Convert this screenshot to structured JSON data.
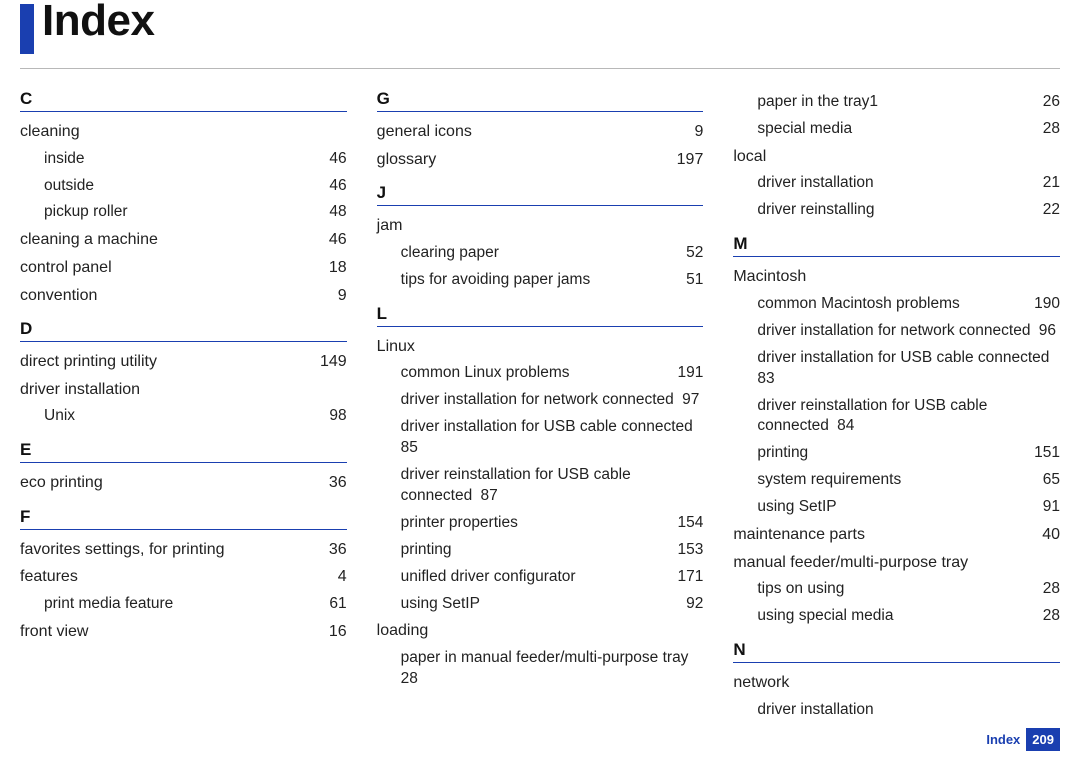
{
  "title": "Index",
  "footer": {
    "label": "Index",
    "page": "209"
  },
  "columns": [
    [
      {
        "type": "letter",
        "text": "C"
      },
      {
        "type": "main",
        "label": "cleaning",
        "page": ""
      },
      {
        "type": "sub",
        "label": "inside",
        "page": "46"
      },
      {
        "type": "sub",
        "label": "outside",
        "page": "46"
      },
      {
        "type": "sub",
        "label": "pickup roller",
        "page": "48"
      },
      {
        "type": "main",
        "label": "cleaning a machine",
        "page": "46"
      },
      {
        "type": "main",
        "label": "control panel",
        "page": "18"
      },
      {
        "type": "main",
        "label": "convention",
        "page": "9"
      },
      {
        "type": "letter",
        "text": "D"
      },
      {
        "type": "main",
        "label": "direct printing utility",
        "page": "149"
      },
      {
        "type": "main",
        "label": "driver installation",
        "page": ""
      },
      {
        "type": "sub",
        "label": "Unix",
        "page": "98"
      },
      {
        "type": "letter",
        "text": "E"
      },
      {
        "type": "main",
        "label": "eco printing",
        "page": "36"
      },
      {
        "type": "letter",
        "text": "F"
      },
      {
        "type": "main",
        "label": "favorites settings, for printing",
        "page": "36"
      },
      {
        "type": "main",
        "label": "features",
        "page": "4"
      },
      {
        "type": "sub",
        "label": "print media feature",
        "page": "61"
      },
      {
        "type": "main",
        "label": "front view",
        "page": "16"
      }
    ],
    [
      {
        "type": "letter",
        "text": "G"
      },
      {
        "type": "main",
        "label": "general icons",
        "page": "9"
      },
      {
        "type": "main",
        "label": "glossary",
        "page": "197"
      },
      {
        "type": "letter",
        "text": "J"
      },
      {
        "type": "main",
        "label": "jam",
        "page": ""
      },
      {
        "type": "sub",
        "label": "clearing paper",
        "page": "52"
      },
      {
        "type": "sub",
        "label": "tips for avoiding paper jams",
        "page": "51"
      },
      {
        "type": "letter",
        "text": "L"
      },
      {
        "type": "main",
        "label": "Linux",
        "page": ""
      },
      {
        "type": "sub",
        "label": "common Linux problems",
        "page": "191"
      },
      {
        "type": "subwrap",
        "label": "driver installation for network connected",
        "page": "97"
      },
      {
        "type": "subwrap",
        "label": "driver installation for USB cable connected",
        "page": "85"
      },
      {
        "type": "subwrap",
        "label": "driver reinstallation for USB cable connected",
        "page": "87"
      },
      {
        "type": "sub",
        "label": "printer properties",
        "page": "154"
      },
      {
        "type": "sub",
        "label": "printing",
        "page": "153"
      },
      {
        "type": "sub",
        "label": "unifled driver configurator",
        "page": "171"
      },
      {
        "type": "sub",
        "label": "using SetIP",
        "page": "92"
      },
      {
        "type": "main",
        "label": "loading",
        "page": ""
      },
      {
        "type": "subwrap",
        "label": "paper in manual feeder/multi-purpose tray",
        "page": "28"
      }
    ],
    [
      {
        "type": "sub",
        "label": "paper in the tray1",
        "page": "26"
      },
      {
        "type": "sub",
        "label": "special media",
        "page": "28"
      },
      {
        "type": "main",
        "label": "local",
        "page": ""
      },
      {
        "type": "sub",
        "label": "driver installation",
        "page": "21"
      },
      {
        "type": "sub",
        "label": "driver reinstalling",
        "page": "22"
      },
      {
        "type": "letter",
        "text": "M"
      },
      {
        "type": "main",
        "label": "Macintosh",
        "page": ""
      },
      {
        "type": "sub",
        "label": "common Macintosh problems",
        "page": "190"
      },
      {
        "type": "subwrap",
        "label": "driver installation for network connected",
        "page": "96"
      },
      {
        "type": "subwrap",
        "label": "driver installation for USB cable connected",
        "page": "83"
      },
      {
        "type": "subwrap",
        "label": "driver reinstallation for USB cable connected",
        "page": "84"
      },
      {
        "type": "sub",
        "label": "printing",
        "page": "151"
      },
      {
        "type": "sub",
        "label": "system requirements",
        "page": "65"
      },
      {
        "type": "sub",
        "label": "using SetIP",
        "page": "91"
      },
      {
        "type": "main",
        "label": "maintenance parts",
        "page": "40"
      },
      {
        "type": "main",
        "label": "manual feeder/multi-purpose tray",
        "page": ""
      },
      {
        "type": "sub",
        "label": "tips on using",
        "page": "28"
      },
      {
        "type": "sub",
        "label": "using special media",
        "page": "28"
      },
      {
        "type": "letter",
        "text": "N"
      },
      {
        "type": "main",
        "label": "network",
        "page": ""
      },
      {
        "type": "sub",
        "label": "driver installation",
        "page": ""
      }
    ]
  ]
}
